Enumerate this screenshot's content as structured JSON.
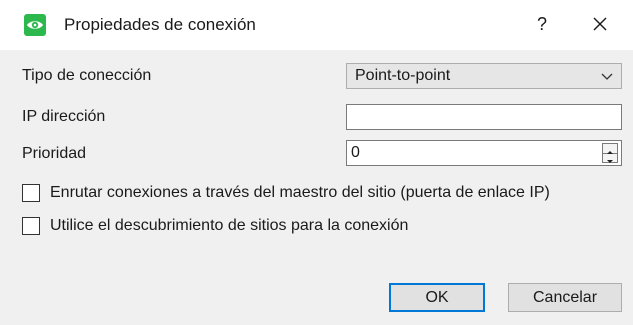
{
  "dialog": {
    "title": "Propiedades de conexión",
    "help_label": "?",
    "icons": {
      "app": "eye-icon",
      "close": "close-icon"
    }
  },
  "form": {
    "connection_type": {
      "label": "Tipo de conección",
      "value": "Point-to-point",
      "icon": "chevron-down-icon"
    },
    "ip_address": {
      "label": "IP dirección",
      "value": ""
    },
    "priority": {
      "label": "Prioridad",
      "value": "0"
    },
    "checkboxes": [
      {
        "label": "Enrutar conexiones a través del maestro del sitio (puerta de enlace IP)",
        "checked": false
      },
      {
        "label": "Utilice el descubrimiento de sitios para la conexión",
        "checked": false
      }
    ]
  },
  "buttons": {
    "ok": "OK",
    "cancel": "Cancelar"
  },
  "colors": {
    "accent": "#0078d7",
    "app_icon": "#2db84d"
  }
}
